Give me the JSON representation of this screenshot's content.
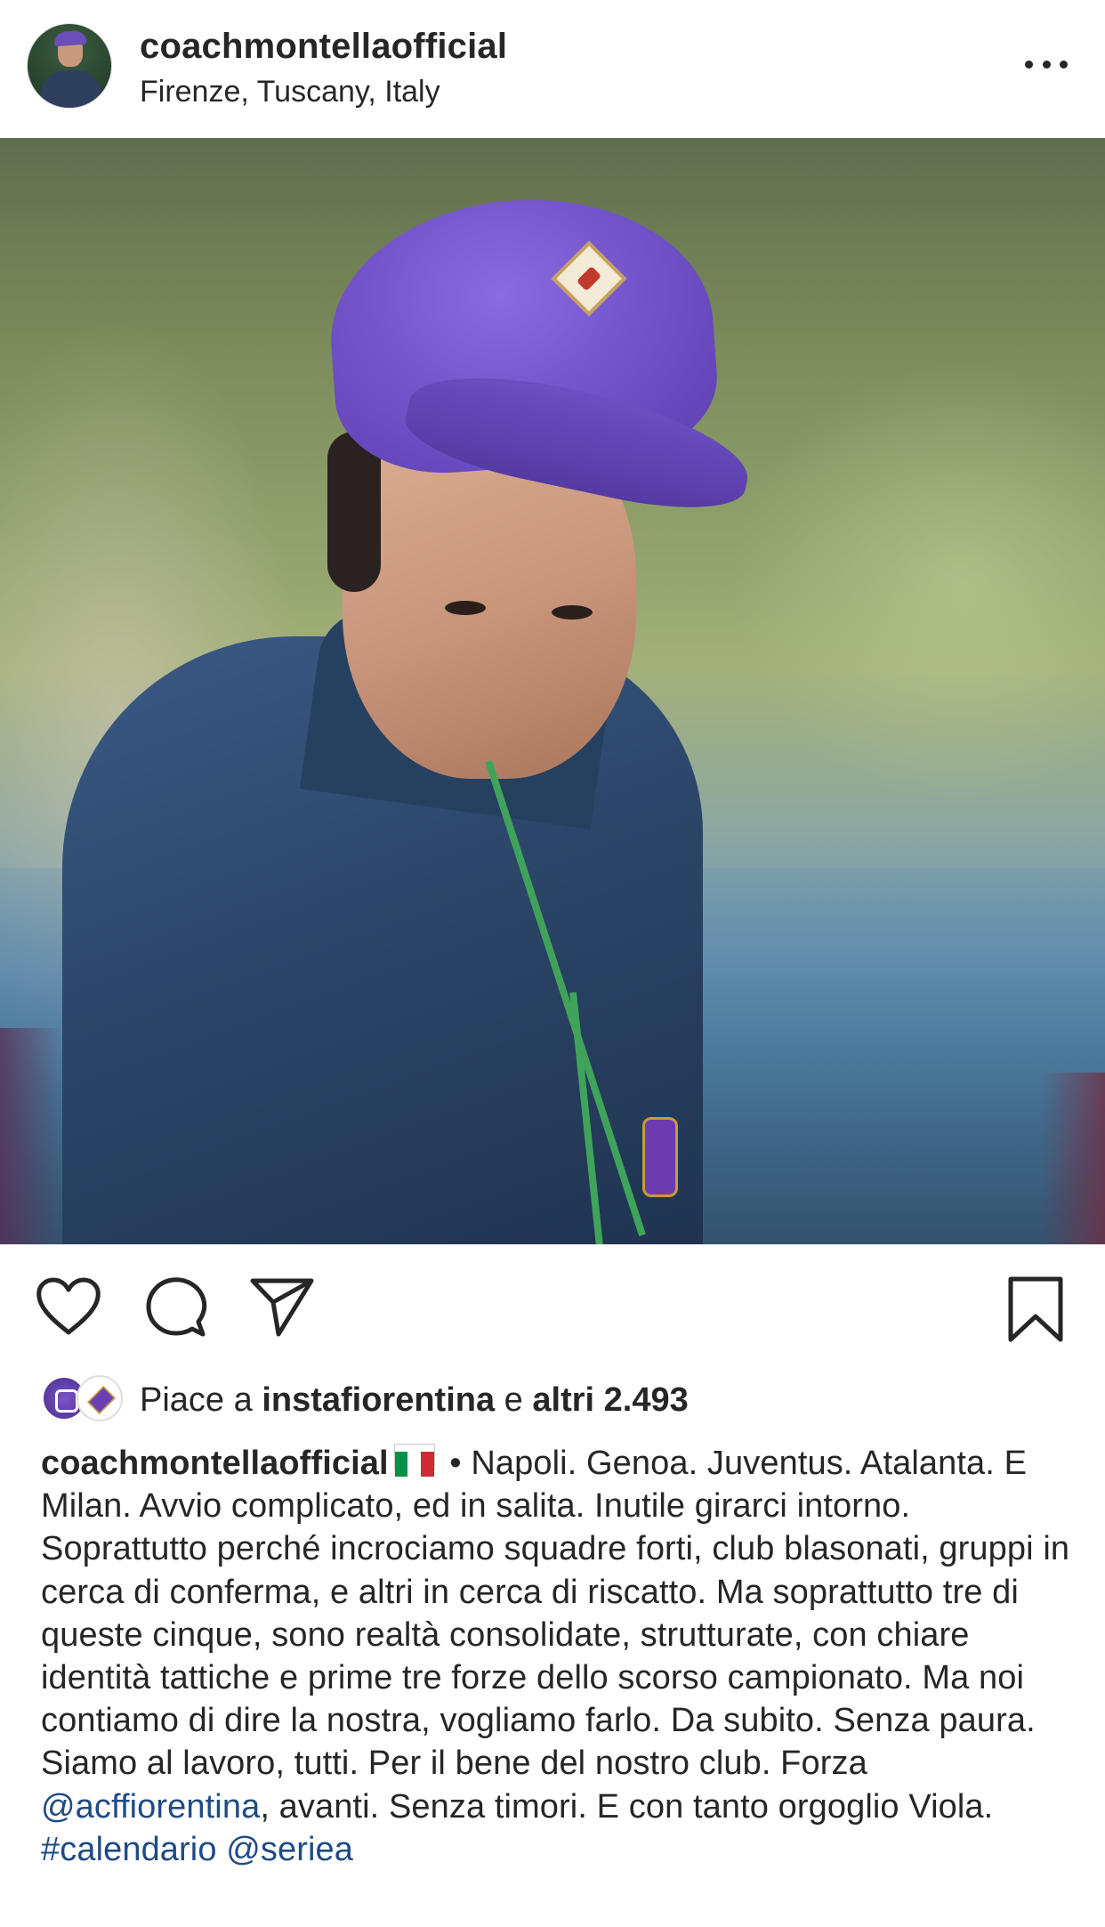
{
  "post": {
    "username": "coachmontellaofficial",
    "location": "Firenze, Tuscany, Italy",
    "more_icon": "more-horizontal-icon"
  },
  "photo": {
    "description_icon": "post-photo"
  },
  "actions": {
    "like_icon": "heart-icon",
    "comment_icon": "comment-icon",
    "share_icon": "paper-plane-icon",
    "save_icon": "bookmark-icon"
  },
  "likes": {
    "prefix": "Piace a ",
    "user": "instafiorentina",
    "middle": " e ",
    "others": "altri 2.493"
  },
  "caption": {
    "author": "coachmontellaofficial",
    "flag": "italy-flag",
    "line1": " • Napoli. Genoa. Juventus.",
    "body": "Atalanta. E Milan. Avvio complicato, ed in salita. Inutile girarci intorno. Soprattutto perché incrociamo squadre forti, club blasonati, gruppi in cerca di conferma, e altri in cerca di riscatto. Ma soprattutto tre di queste cinque, sono realtà consolidate, strutturate, con chiare identità tattiche e prime tre forze dello scorso campionato. Ma noi contiamo di dire la nostra, vogliamo farlo. Da subito. Senza paura. Siamo al lavoro, tutti. Per il bene del nostro club. Forza ",
    "mention1": "@acffiorentina",
    "after_mention": ", avanti. Senza timori. E con tanto orgoglio Viola. ",
    "hashtag": "#calendario",
    "mention2": "@seriea"
  },
  "colors": {
    "text": "#262626",
    "link": "#1e4b86",
    "cap_purple": "#7455cc"
  }
}
